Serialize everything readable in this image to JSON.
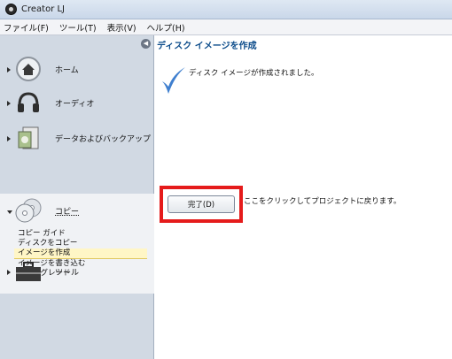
{
  "window": {
    "title": "Creator LJ"
  },
  "menu": [
    "ファイル(F)",
    "ツール(T)",
    "表示(V)",
    "ヘルプ(H)"
  ],
  "sidebar": {
    "nav": [
      {
        "label": "ホーム",
        "icon": "home-icon"
      },
      {
        "label": "オーディオ",
        "icon": "headphones-icon"
      },
      {
        "label": "データおよびバックアップ",
        "icon": "data-backup-icon"
      },
      {
        "label": "コピー",
        "icon": "disc-copy-icon"
      },
      {
        "label": "ツール",
        "icon": "toolbox-icon"
      }
    ],
    "copy_subitems": [
      "コピー ガイド",
      "ディスクをコピー",
      "イメージを作成",
      "イメージを書き込む",
      "アップグレード"
    ],
    "active_subitem": "イメージを作成"
  },
  "main": {
    "heading": "ディスク イメージを作成",
    "message": "ディスク イメージが作成されました。",
    "finish_button": "完了(D)",
    "hint": "ここをクリックしてプロジェクトに戻ります。"
  },
  "colors": {
    "highlight": "#e51b1b",
    "heading": "#0b4b8a",
    "sidebar": "#d1d9e3"
  }
}
